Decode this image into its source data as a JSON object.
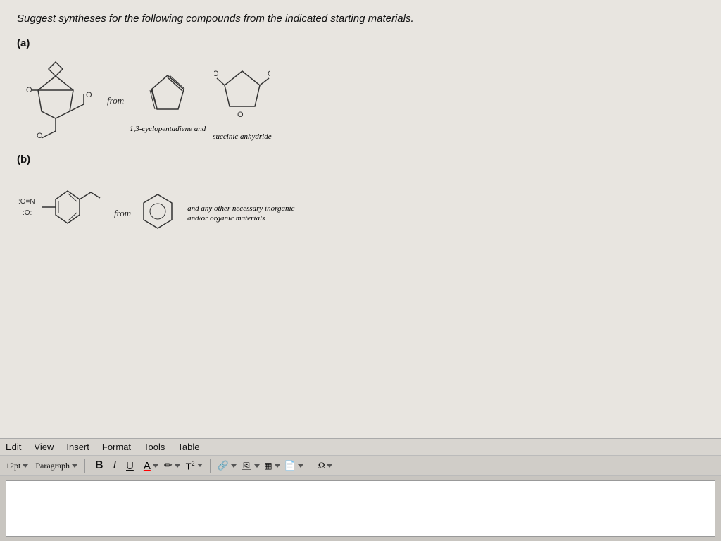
{
  "page": {
    "question_text": "Suggest syntheses for the following compounds from the indicated starting materials.",
    "part_a": {
      "label": "(a)",
      "from_text": "from",
      "compound_label": "1,3-cyclopentadiene and",
      "product_label": "",
      "reagent_label": "succinic anhydride"
    },
    "part_b": {
      "label": "(b)",
      "from_text": "from",
      "reagent_label": "and any other necessary inorganic\nand/or organic materials"
    },
    "menu": {
      "edit": "Edit",
      "view": "View",
      "insert": "Insert",
      "format": "Format",
      "tools": "Tools",
      "table": "Table"
    },
    "toolbar": {
      "font_size": "12pt",
      "paragraph": "Paragraph",
      "bold": "B",
      "italic": "I",
      "underline": "U",
      "superscript_label": "T²"
    }
  }
}
